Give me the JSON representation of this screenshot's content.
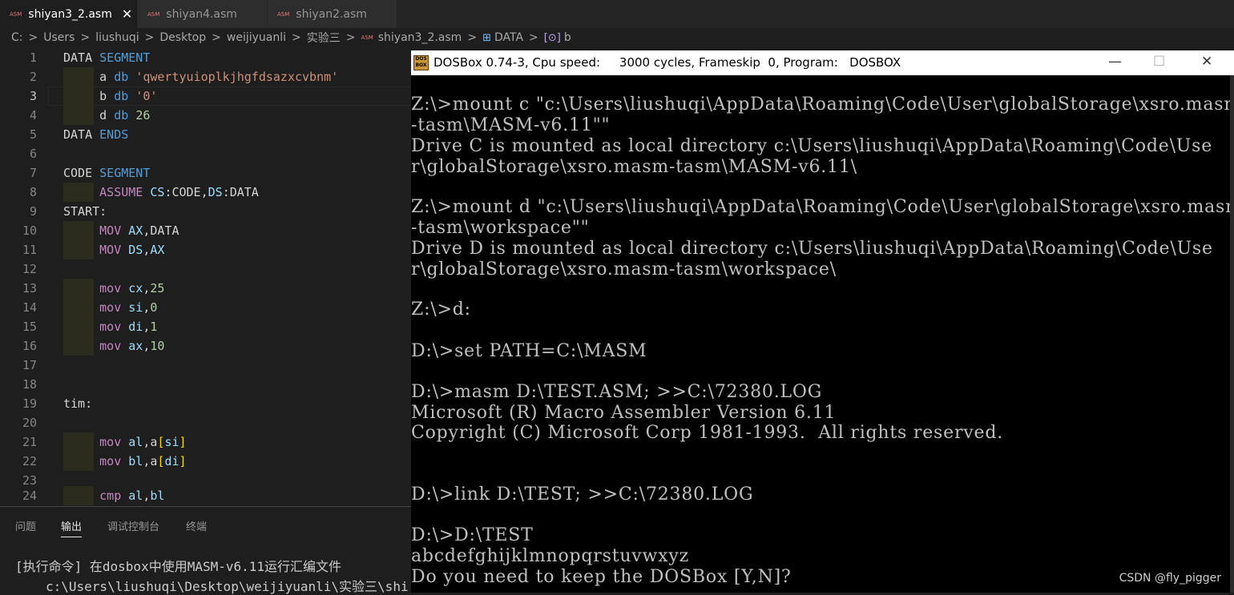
{
  "tabs": [
    {
      "badge": "ASM",
      "label": "shiyan3_2.asm",
      "close": "✕"
    },
    {
      "badge": "ASM",
      "label": "shiyan4.asm"
    },
    {
      "badge": "ASM",
      "label": "shiyan2.asm"
    }
  ],
  "breadcrumb": [
    "C:",
    "Users",
    "liushuqi",
    "Desktop",
    "weijiyuanli",
    "实验三",
    "shiyan3_2.asm",
    "DATA",
    "b"
  ],
  "breadcrumb_sep": ">",
  "editor": {
    "line_numbers": [
      "1",
      "2",
      "3",
      "4",
      "5",
      "6",
      "7",
      "8",
      "9",
      "10",
      "11",
      "12",
      "13",
      "14",
      "15",
      "16",
      "17",
      "18",
      "19",
      "20",
      "21",
      "22",
      "23",
      "24"
    ]
  },
  "panel": {
    "tabs": [
      "问题",
      "输出",
      "调试控制台",
      "终端"
    ],
    "output_line1": "[执行命令] 在dosbox中使用MASM-v6.11运行汇编文件",
    "output_line2": "c:\\Users\\liushuqi\\Desktop\\weijiyuanli\\实验三\\shi"
  },
  "dosbox": {
    "title": "DOSBox 0.74-3, Cpu speed:     3000 cycles, Frameskip  0, Program:   DOSBOX",
    "icon_text": "DOS BOX",
    "minimize": "—",
    "maximize": "☐",
    "close": "✕",
    "lines": [
      "Z:\\>mount c \"c:\\Users\\liushuqi\\AppData\\Roaming\\Code\\User\\globalStorage\\xsro.masm",
      "-tasm\\MASM-v6.11\"\"",
      "Drive C is mounted as local directory c:\\Users\\liushuqi\\AppData\\Roaming\\Code\\Use",
      "r\\globalStorage\\xsro.masm-tasm\\MASM-v6.11\\",
      "",
      "Z:\\>mount d \"c:\\Users\\liushuqi\\AppData\\Roaming\\Code\\User\\globalStorage\\xsro.masm",
      "-tasm\\workspace\"\"",
      "Drive D is mounted as local directory c:\\Users\\liushuqi\\AppData\\Roaming\\Code\\Use",
      "r\\globalStorage\\xsro.masm-tasm\\workspace\\",
      "",
      "Z:\\>d:",
      "",
      "D:\\>set PATH=C:\\MASM",
      "",
      "D:\\>masm D:\\TEST.ASM; >>C:\\72380.LOG",
      "Microsoft (R) Macro Assembler Version 6.11",
      "Copyright (C) Microsoft Corp 1981-1993.  All rights reserved.",
      "",
      "",
      "D:\\>link D:\\TEST; >>C:\\72380.LOG",
      "",
      "D:\\>D:\\TEST",
      "abcdefghijklmnopqrstuvwxyz",
      "Do you need to keep the DOSBox [Y,N]?"
    ]
  },
  "watermark": "CSDN @fly_pigger"
}
